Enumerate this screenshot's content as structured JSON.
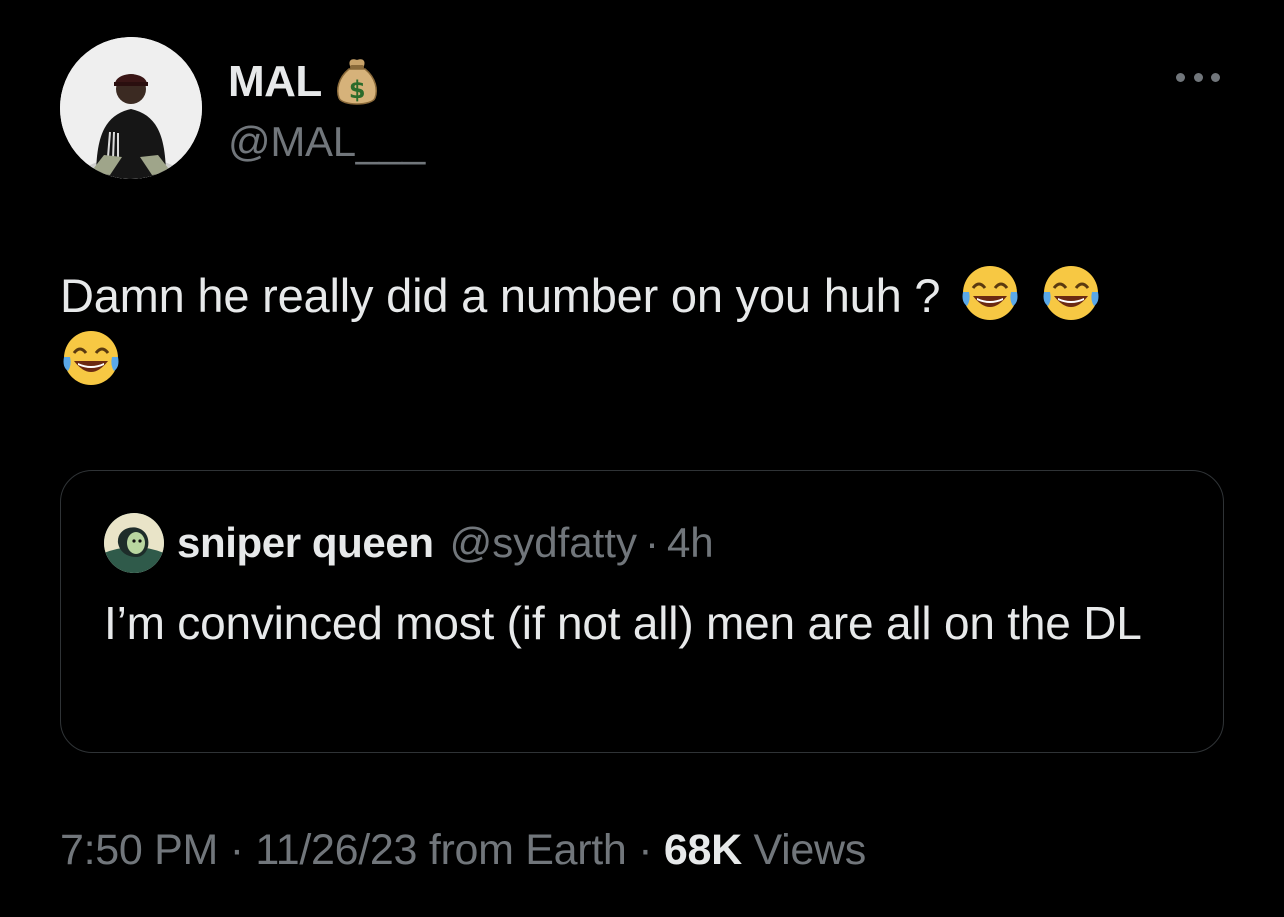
{
  "author": {
    "display_name": "MAL",
    "name_emoji": "moneybag-emoji",
    "handle": "@MAL___"
  },
  "tweet": {
    "text": "Damn he really did a number on you huh ?",
    "emojis": [
      "face-with-tears-of-joy-emoji",
      "face-with-tears-of-joy-emoji",
      "face-with-tears-of-joy-emoji"
    ]
  },
  "quoted_tweet": {
    "display_name": "sniper queen",
    "handle": "@sydfatty",
    "separator": "·",
    "time": "4h",
    "text": "I’m convinced most (if not all) men are all on the DL"
  },
  "meta": {
    "time": "7:50 PM",
    "separator1": " · ",
    "date": "11/26/23",
    "source": " from Earth",
    "separator2": " · ",
    "views_count": "68K",
    "views_label": " Views"
  },
  "icons": {
    "more": "more-options-icon"
  },
  "colors": {
    "background": "#000000",
    "primary_text": "#e7e9ea",
    "secondary_text": "#71767b",
    "border": "#2f3336"
  }
}
